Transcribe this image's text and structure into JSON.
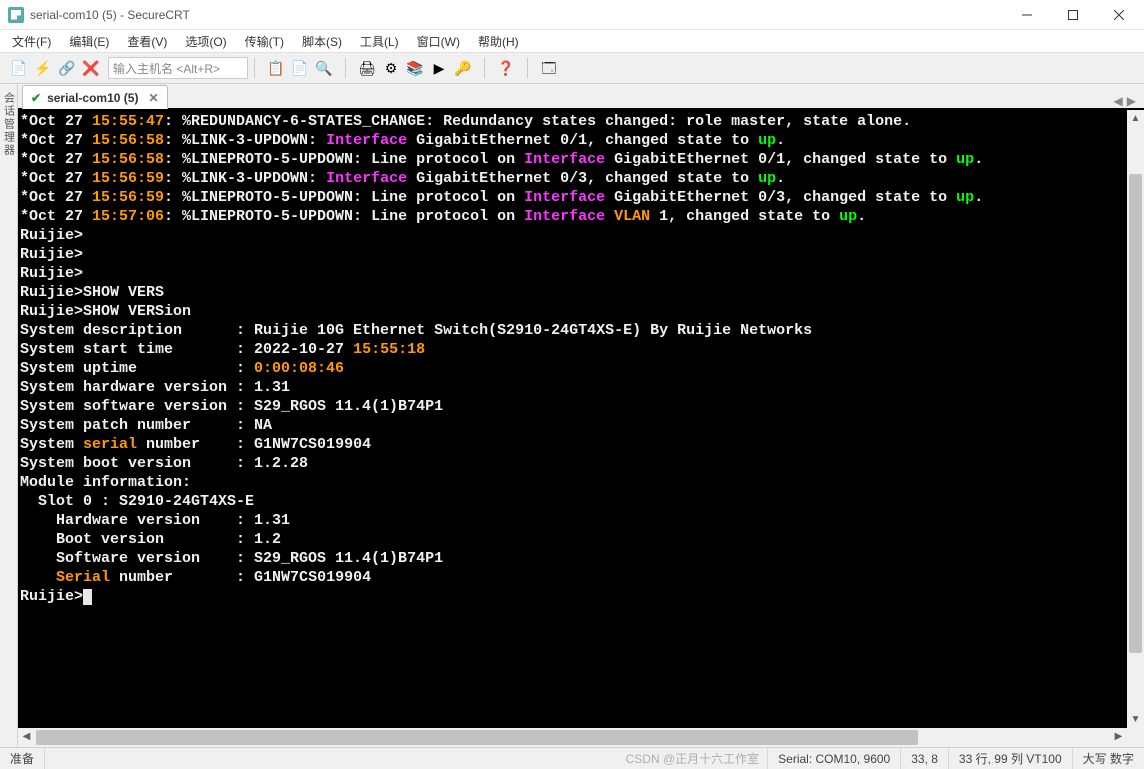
{
  "window": {
    "title": "serial-com10 (5) - SecureCRT",
    "min_tooltip": "最小化",
    "max_tooltip": "最大化",
    "close_tooltip": "关闭"
  },
  "menubar": {
    "file": "文件(F)",
    "edit": "编辑(E)",
    "view": "查看(V)",
    "options": "选项(O)",
    "transfer": "传输(T)",
    "script": "脚本(S)",
    "tools": "工具(L)",
    "window": "窗口(W)",
    "help": "帮助(H)"
  },
  "toolbar": {
    "host_placeholder": "输入主机名 <Alt+R>",
    "icons": {
      "new_session": "new-session-icon",
      "quick_connect": "quick-connect-icon",
      "connect_sftp": "connect-sftp-icon",
      "reconnect": "reconnect-icon",
      "copy": "copy-icon",
      "paste": "paste-icon",
      "find": "find-icon",
      "print": "print-icon",
      "options": "options-icon",
      "sessions": "sessions-icon",
      "script_run": "script-run-icon",
      "keymap": "keymap-icon",
      "help": "help-icon",
      "toggle": "toggle-icon"
    }
  },
  "sidebar": {
    "label": "会话管理器"
  },
  "tab": {
    "name": "serial-com10 (5)",
    "connected": true
  },
  "terminal": {
    "lines": [
      {
        "segments": [
          {
            "c": "white",
            "t": "*Oct 27 "
          },
          {
            "c": "orange",
            "t": "15:55:47"
          },
          {
            "c": "white",
            "t": ": %REDUNDANCY-6-STATES_CHANGE: Redundancy states changed: role master, state alone."
          }
        ]
      },
      {
        "segments": [
          {
            "c": "white",
            "t": ""
          }
        ]
      },
      {
        "segments": [
          {
            "c": "white",
            "t": ""
          }
        ]
      },
      {
        "segments": [
          {
            "c": "white",
            "t": ""
          }
        ]
      },
      {
        "segments": [
          {
            "c": "white",
            "t": "*Oct 27 "
          },
          {
            "c": "orange",
            "t": "15:56:58"
          },
          {
            "c": "white",
            "t": ": %LINK-3-UPDOWN: "
          },
          {
            "c": "magenta",
            "t": "Interface"
          },
          {
            "c": "white",
            "t": " GigabitEthernet 0/1, changed state to "
          },
          {
            "c": "green",
            "t": "up"
          },
          {
            "c": "white",
            "t": "."
          }
        ]
      },
      {
        "segments": [
          {
            "c": "white",
            "t": "*Oct 27 "
          },
          {
            "c": "orange",
            "t": "15:56:58"
          },
          {
            "c": "white",
            "t": ": %LINEPROTO-5-UPDOWN: Line protocol on "
          },
          {
            "c": "magenta",
            "t": "Interface"
          },
          {
            "c": "white",
            "t": " GigabitEthernet 0/1, changed state to "
          },
          {
            "c": "green",
            "t": "up"
          },
          {
            "c": "white",
            "t": "."
          }
        ]
      },
      {
        "segments": [
          {
            "c": "white",
            "t": "*Oct 27 "
          },
          {
            "c": "orange",
            "t": "15:56:59"
          },
          {
            "c": "white",
            "t": ": %LINK-3-UPDOWN: "
          },
          {
            "c": "magenta",
            "t": "Interface"
          },
          {
            "c": "white",
            "t": " GigabitEthernet 0/3, changed state to "
          },
          {
            "c": "green",
            "t": "up"
          },
          {
            "c": "white",
            "t": "."
          }
        ]
      },
      {
        "segments": [
          {
            "c": "white",
            "t": "*Oct 27 "
          },
          {
            "c": "orange",
            "t": "15:56:59"
          },
          {
            "c": "white",
            "t": ": %LINEPROTO-5-UPDOWN: Line protocol on "
          },
          {
            "c": "magenta",
            "t": "Interface"
          },
          {
            "c": "white",
            "t": " GigabitEthernet 0/3, changed state to "
          },
          {
            "c": "green",
            "t": "up"
          },
          {
            "c": "white",
            "t": "."
          }
        ]
      },
      {
        "segments": [
          {
            "c": "white",
            "t": "*Oct 27 "
          },
          {
            "c": "orange",
            "t": "15:57:06"
          },
          {
            "c": "white",
            "t": ": %LINEPROTO-5-UPDOWN: Line protocol on "
          },
          {
            "c": "magenta",
            "t": "Interface"
          },
          {
            "c": "orange",
            "t": " VLAN"
          },
          {
            "c": "white",
            "t": " 1, changed state to "
          },
          {
            "c": "green",
            "t": "up"
          },
          {
            "c": "white",
            "t": "."
          }
        ]
      },
      {
        "segments": [
          {
            "c": "white",
            "t": ""
          }
        ]
      },
      {
        "segments": [
          {
            "c": "white",
            "t": ""
          }
        ]
      },
      {
        "segments": [
          {
            "c": "white",
            "t": "Ruijie>"
          }
        ]
      },
      {
        "segments": [
          {
            "c": "white",
            "t": "Ruijie>"
          }
        ]
      },
      {
        "segments": [
          {
            "c": "white",
            "t": "Ruijie>"
          }
        ]
      },
      {
        "segments": [
          {
            "c": "white",
            "t": "Ruijie>SHOW VERS"
          }
        ]
      },
      {
        "segments": [
          {
            "c": "white",
            "t": "Ruijie>SHOW VERSion"
          }
        ]
      },
      {
        "segments": [
          {
            "c": "white",
            "t": "System description      : Ruijie 10G Ethernet Switch(S2910-24GT4XS-E) By Ruijie Networks"
          }
        ]
      },
      {
        "segments": [
          {
            "c": "white",
            "t": "System start time       : 2022-10-27 "
          },
          {
            "c": "orange",
            "t": "15:55:18"
          }
        ]
      },
      {
        "segments": [
          {
            "c": "white",
            "t": "System uptime           : "
          },
          {
            "c": "orange",
            "t": "0:00:08:46"
          }
        ]
      },
      {
        "segments": [
          {
            "c": "white",
            "t": "System hardware version : 1.31"
          }
        ]
      },
      {
        "segments": [
          {
            "c": "white",
            "t": "System software version : S29_RGOS 11.4(1)B74P1"
          }
        ]
      },
      {
        "segments": [
          {
            "c": "white",
            "t": "System patch number     : NA"
          }
        ]
      },
      {
        "segments": [
          {
            "c": "white",
            "t": "System "
          },
          {
            "c": "orange",
            "t": "serial"
          },
          {
            "c": "white",
            "t": " number    : G1NW7CS019904"
          }
        ]
      },
      {
        "segments": [
          {
            "c": "white",
            "t": "System boot version     : 1.2.28"
          }
        ]
      },
      {
        "segments": [
          {
            "c": "white",
            "t": "Module information:"
          }
        ]
      },
      {
        "segments": [
          {
            "c": "white",
            "t": "  Slot 0 : S2910-24GT4XS-E"
          }
        ]
      },
      {
        "segments": [
          {
            "c": "white",
            "t": "    Hardware version    : 1.31"
          }
        ]
      },
      {
        "segments": [
          {
            "c": "white",
            "t": "    Boot version        : 1.2"
          }
        ]
      },
      {
        "segments": [
          {
            "c": "white",
            "t": "    Software version    : S29_RGOS 11.4(1)B74P1"
          }
        ]
      },
      {
        "segments": [
          {
            "c": "white",
            "t": "    "
          },
          {
            "c": "orange",
            "t": "Serial"
          },
          {
            "c": "white",
            "t": " number       : G1NW7CS019904"
          }
        ]
      },
      {
        "segments": [
          {
            "c": "white",
            "t": "Ruijie>"
          },
          {
            "cursor": true
          }
        ]
      }
    ],
    "wrap_width": 115
  },
  "statusbar": {
    "ready": "准备",
    "conn": "Serial: COM10, 9600",
    "cursor": "33,  8",
    "size": "33 行, 99 列  VT100",
    "caps": "大写 数字",
    "watermark": "CSDN @正月十六工作室"
  }
}
